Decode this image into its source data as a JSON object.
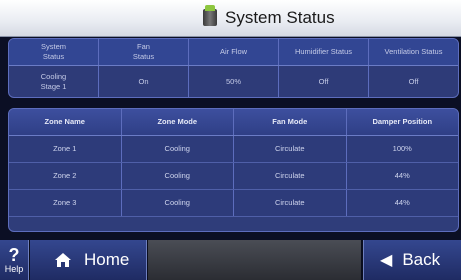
{
  "header": {
    "title": "System Status",
    "icon": "thermostat-unit-icon"
  },
  "status_panel": {
    "headers": [
      "System\nStatus",
      "Fan\nStatus",
      "Air Flow",
      "Humidifier Status",
      "Ventilation Status"
    ],
    "values": [
      "Cooling\nStage 1",
      "On",
      "50%",
      "Off",
      "Off"
    ]
  },
  "zones": {
    "headers": [
      "Zone Name",
      "Zone Mode",
      "Fan Mode",
      "Damper Position"
    ],
    "rows": [
      [
        "Zone 1",
        "Cooling",
        "Circulate",
        "100%"
      ],
      [
        "Zone 2",
        "Cooling",
        "Circulate",
        "44%"
      ],
      [
        "Zone 3",
        "Cooling",
        "Circulate",
        "44%"
      ]
    ]
  },
  "footer": {
    "help": "?",
    "help_label": "Help",
    "home": "Home",
    "back": "Back"
  },
  "colors": {
    "panel": "#2e3b78",
    "header_bg": "#e9ecf2",
    "accent": "#8dc63f"
  }
}
